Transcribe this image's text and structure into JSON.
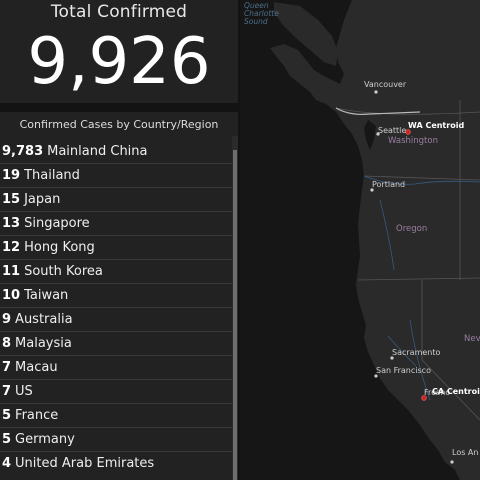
{
  "total": {
    "title": "Total Confirmed",
    "value": "9,926"
  },
  "list": {
    "title": "Confirmed Cases by Country/Region",
    "rows": [
      {
        "count": "9,783",
        "name": "Mainland China"
      },
      {
        "count": "19",
        "name": "Thailand"
      },
      {
        "count": "15",
        "name": "Japan"
      },
      {
        "count": "13",
        "name": "Singapore"
      },
      {
        "count": "12",
        "name": "Hong Kong"
      },
      {
        "count": "11",
        "name": "South Korea"
      },
      {
        "count": "10",
        "name": "Taiwan"
      },
      {
        "count": "9",
        "name": "Australia"
      },
      {
        "count": "8",
        "name": "Malaysia"
      },
      {
        "count": "7",
        "name": "Macau"
      },
      {
        "count": "7",
        "name": "US"
      },
      {
        "count": "5",
        "name": "France"
      },
      {
        "count": "5",
        "name": "Germany"
      },
      {
        "count": "4",
        "name": "United Arab Emirates"
      }
    ]
  },
  "map": {
    "water_label": "Queen\nCharlotte\nSound",
    "cities": [
      "Vancouver",
      "Seattle",
      "Portland",
      "Sacramento",
      "San Francisco",
      "Fresno",
      "Los An"
    ],
    "states": [
      "Washington",
      "Oregon",
      "Nev"
    ],
    "centroids": [
      "WA Centroid",
      "CA Centroid"
    ]
  },
  "colors": {
    "panel": "#222222",
    "map_land": "#2a2a2a",
    "map_water": "#161616",
    "marker": "#c62828"
  }
}
